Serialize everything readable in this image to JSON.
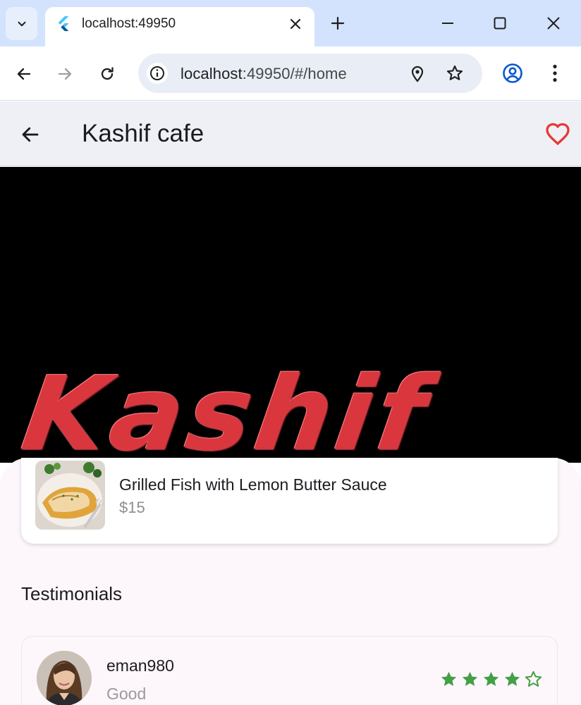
{
  "browser": {
    "tab_title": "localhost:49950",
    "url_host": "localhost",
    "url_path": ":49950/#/home",
    "icons": {
      "tab_search": "chevron-down-icon",
      "favicon": "flutter-logo-icon",
      "tab_close": "close-icon",
      "new_tab": "plus-icon",
      "minimize": "minimize-icon",
      "maximize": "maximize-icon",
      "close_window": "close-icon",
      "back": "arrow-left-icon",
      "forward": "arrow-right-icon",
      "reload": "reload-icon",
      "site_info": "info-icon",
      "location": "location-pin-icon",
      "bookmark": "star-outline-icon",
      "profile": "account-circle-icon",
      "menu": "more-vert-icon"
    }
  },
  "app": {
    "title": "Kashif cafe",
    "favorite_color": "#e53935",
    "hero_word": "Kashif",
    "dish": {
      "name": "Grilled Fish with Lemon Butter Sauce",
      "price": "$15"
    },
    "testimonials_title": "Testimonials",
    "review": {
      "user": "eman980",
      "text": "Good",
      "rating": 4,
      "max_rating": 5,
      "star_color": "#43a047"
    }
  }
}
